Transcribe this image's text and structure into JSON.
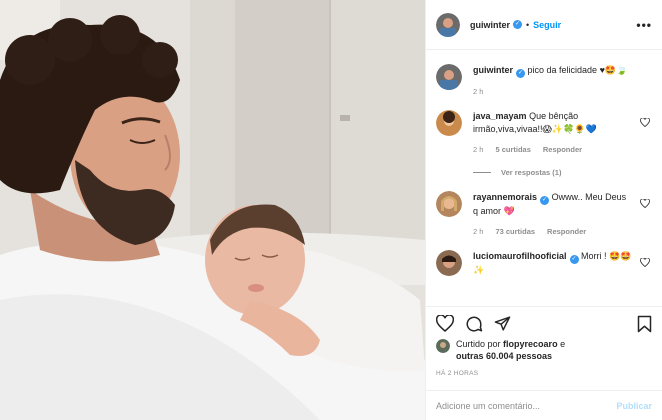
{
  "header": {
    "username": "guiwinter",
    "verified_icon": "verified-badge-icon",
    "separator": "•",
    "follow_label": "Seguir",
    "more_label": "•••"
  },
  "caption": {
    "username": "guiwinter",
    "text": "pico da felicidade ♥🤩🍃",
    "time": "2 h"
  },
  "comments": [
    {
      "username": "java_mayam",
      "text": "Que bênção irmão,viva,vivaa!!😱✨🍀🌻💙",
      "time": "2 h",
      "likes": "5 curtidas",
      "reply_label": "Responder",
      "view_replies": "Ver respostas (1)"
    },
    {
      "username": "rayannemorais",
      "text": "Owww.. Meu Deus q amor 💖",
      "time": "2 h",
      "likes": "73 curtidas",
      "reply_label": "Responder"
    },
    {
      "username": "luciomaurofilhooficial",
      "text": "Morri ! 🤩🤩✨"
    }
  ],
  "liked_by": {
    "prefix": "Curtido por",
    "user": "flopyrecoaro",
    "and": "e",
    "others": "outras 60.004 pessoas"
  },
  "timestamp": "HÁ 2 HORAS",
  "comment_box": {
    "placeholder": "Adicione um comentário...",
    "publish_label": "Publicar"
  },
  "colors": {
    "accent": "#0095f6",
    "publish_disabled": "#b2dffc",
    "muted": "#8e8e8e"
  }
}
